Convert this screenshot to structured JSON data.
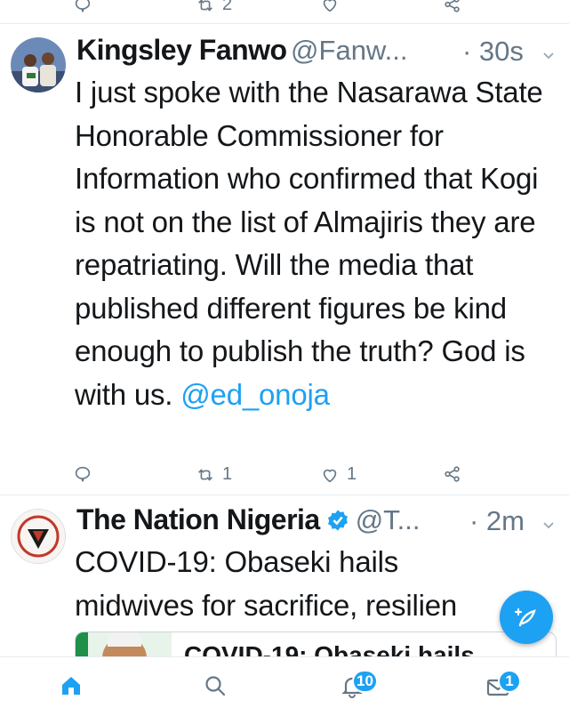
{
  "top_actions": {
    "retweets": "2"
  },
  "tweets": [
    {
      "name": "Kingsley Fanwo",
      "handle": "@Fanw...",
      "time": "· 30s",
      "body": "I just spoke with the Nasarawa State Honorable Commissioner for Information who confirmed that Kogi is not on the list of Almajiris they are repatriating. Will the media that published different figures be kind enough to publish the truth? God is with us.",
      "mention": "@ed_onoja",
      "retweets": "1",
      "likes": "1"
    },
    {
      "name": "The Nation Nigeria",
      "handle": "@T...",
      "time": "· 2m",
      "body": "COVID-19: Obaseki hails midwives for sacrifice, resilien",
      "card_title": "COVID-19: Obaseki hails"
    }
  ],
  "nav": {
    "notifications_count": "10",
    "messages_count": "1"
  },
  "colors": {
    "accent": "#1da1f2",
    "muted": "#657786",
    "divider": "#e6ecf0"
  }
}
